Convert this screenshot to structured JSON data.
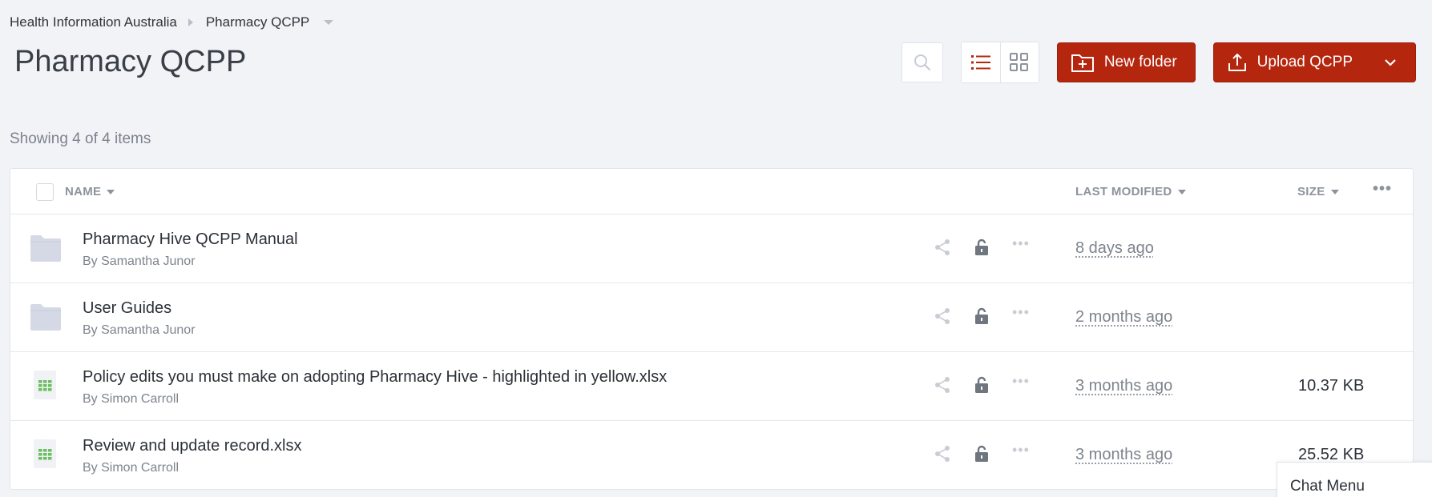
{
  "breadcrumb": {
    "root": "Health Information Australia",
    "current": "Pharmacy QCPP"
  },
  "page": {
    "title": "Pharmacy QCPP",
    "showing": "Showing 4 of 4 items"
  },
  "toolbar": {
    "new_folder_label": "New folder",
    "upload_label": "Upload QCPP",
    "search_icon": "search-icon",
    "list_view_icon": "list-view-icon",
    "grid_view_icon": "grid-view-icon",
    "active_view": "list"
  },
  "table": {
    "columns": {
      "name": "NAME",
      "last_modified": "LAST MODIFIED",
      "size": "SIZE"
    },
    "rows": [
      {
        "type": "folder",
        "name": "Pharmacy Hive QCPP Manual",
        "by": "By Samantha Junor",
        "modified": "8 days ago",
        "size": ""
      },
      {
        "type": "folder",
        "name": "User Guides",
        "by": "By Samantha Junor",
        "modified": "2 months ago",
        "size": ""
      },
      {
        "type": "spreadsheet",
        "name": "Policy edits you must make on adopting Pharmacy Hive - highlighted in yellow.xlsx",
        "by": "By Simon Carroll",
        "modified": "3 months ago",
        "size": "10.37 KB"
      },
      {
        "type": "spreadsheet",
        "name": "Review and update record.xlsx",
        "by": "By Simon Carroll",
        "modified": "3 months ago",
        "size": "25.52 KB"
      }
    ]
  },
  "chat": {
    "label": "Chat Menu"
  },
  "colors": {
    "accent": "#b5260f",
    "background": "#f1f3f7",
    "folder": "#d5d9e6",
    "spreadsheet": "#6abf5e"
  }
}
